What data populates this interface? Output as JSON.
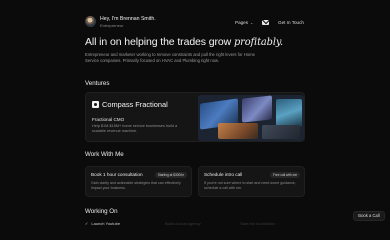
{
  "header": {
    "name": "Hey, I'm Brennan Smith.",
    "role": "Entrepreneur",
    "nav_pages": "Pages",
    "nav_touch": "Get In Touch"
  },
  "hero": {
    "headline_prefix": "All in on helping the trades grow",
    "headline_italic": "profitably.",
    "intro": "Entrepreneur and marketer working to remove constraints and pull the right levers for Home Service companies. Primarily focused on HVAC and Plumbing right now."
  },
  "ventures": {
    "title": "Ventures",
    "card": {
      "brand": "Compass Fractional",
      "role": "Fractional CMO",
      "desc": "Help $1M-$15M+ home service businesses build a scalable revenue machine."
    }
  },
  "work": {
    "title": "Work With Me",
    "cards": [
      {
        "title": "Book 1 hour consultation",
        "badge": "Starting at $300/hr",
        "desc": "Gain clarity and actionable strategies that can effectively impact your business."
      },
      {
        "title": "Schedule intro call",
        "badge": "Free call with me",
        "desc": "If you're not sure where to start and need some guidance, schedule a call with me."
      }
    ]
  },
  "working_on": {
    "title": "Working On",
    "items": [
      "Launch Youtube",
      "Build a local agency",
      "Start the foundation"
    ]
  },
  "book_call": "Book a Call",
  "colors": {
    "background": "#0b0b0b",
    "card": "#151515",
    "text": "#e9e9e9",
    "muted": "#8d8d8d"
  }
}
